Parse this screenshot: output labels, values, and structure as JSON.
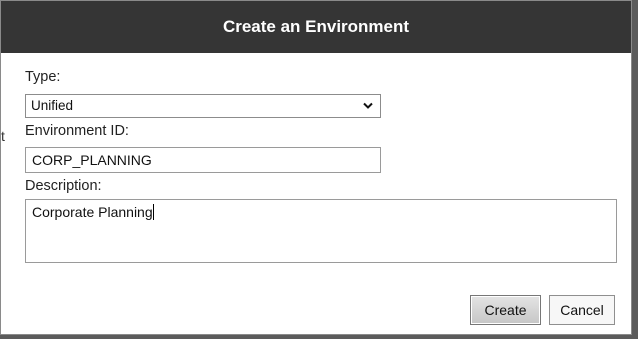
{
  "dialog": {
    "title": "Create an Environment",
    "edge_glyph": "t"
  },
  "form": {
    "type_label": "Type:",
    "type_value": "Unified",
    "env_id_label": "Environment ID:",
    "env_id_value": "CORP_PLANNING",
    "description_label": "Description:",
    "description_value": "Corporate Planning"
  },
  "buttons": {
    "create": "Create",
    "cancel": "Cancel"
  },
  "icons": {
    "select_arrow": "chevron-down-icon"
  },
  "colors": {
    "titlebar": "#353535",
    "primary_button": "#d4d4d4"
  }
}
